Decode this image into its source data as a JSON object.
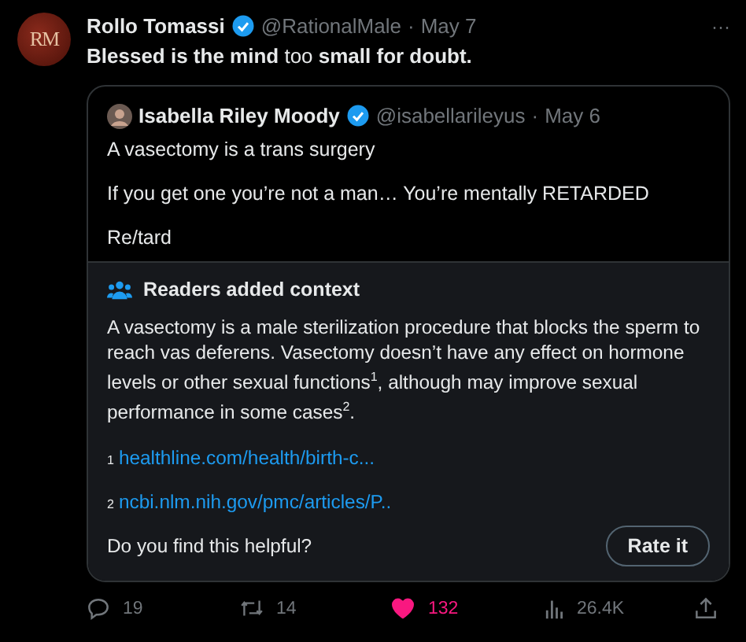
{
  "tweet": {
    "avatar_text": "RM",
    "author": "Rollo Tomassi",
    "verified": true,
    "handle": "@RationalMale",
    "separator": "·",
    "date": "May 7",
    "more": "···",
    "text": "**Blessed is the mind** too **small for doubt.**"
  },
  "quote": {
    "author": "Isabella Riley Moody",
    "verified": true,
    "handle": "@isabellarileyus",
    "separator": "·",
    "date": "May 6",
    "lines": [
      "A vasectomy is a trans surgery",
      "If you get one you’re not a man… You’re mentally RETARDED",
      "Re/tard"
    ]
  },
  "note": {
    "title": "Readers added context",
    "text": "A vasectomy is a male sterilization procedure that blocks the sperm to reach vas deferens. Vasectomy doesn’t have any effect on hormone levels or other sexual functions$^{1}$, although may improve sexual performance in some cases$^{2}$.",
    "sources": [
      {
        "number": "1",
        "link": "healthline.com/health/birth-c..."
      },
      {
        "number": "2",
        "link": "ncbi.nlm.nih.gov/pmc/articles/P.."
      }
    ],
    "question": "Do you find this helpful?",
    "button": "Rate it"
  },
  "actions": [
    {
      "kind": "reply",
      "count": "19",
      "selected": false
    },
    {
      "kind": "repost",
      "count": "14",
      "selected": false
    },
    {
      "kind": "like",
      "count": "132",
      "selected": true
    },
    {
      "kind": "views",
      "count": "26.4K",
      "selected": false
    },
    {
      "kind": "share",
      "selected": false
    }
  ]
}
